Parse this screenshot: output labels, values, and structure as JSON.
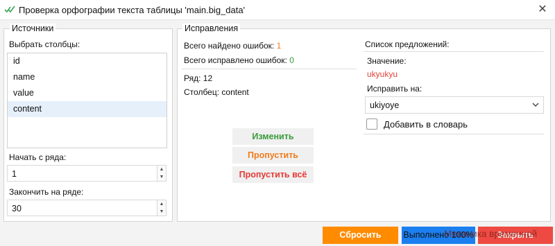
{
  "window": {
    "title": "Проверка орфографии текста таблицы 'main.big_data'",
    "close_glyph": "✕"
  },
  "sources": {
    "legend": "Источники",
    "select_columns_label": "Выбрать столбцы:",
    "columns": [
      "id",
      "name",
      "value",
      "content"
    ],
    "selected_column": "content",
    "start_row_label": "Начать с ряда:",
    "start_row_value": "1",
    "end_row_label": "Закончить на ряде:",
    "end_row_value": "30"
  },
  "fixes": {
    "legend": "Исправления",
    "errors_found_label": "Всего найдено ошибок:",
    "errors_found_value": "1",
    "errors_fixed_label": "Всего исправлено ошибок:",
    "errors_fixed_value": "0",
    "row_label": "Ряд: 12",
    "column_label": "Столбец: content",
    "change_button": "Изменить",
    "skip_button": "Пропустить",
    "skip_all_button": "Пропустить всё"
  },
  "suggestions": {
    "title": "Список предложений:",
    "value_label": "Значение:",
    "value": "ukyukyu",
    "fix_to_label": "Исправить на:",
    "fix_to_value": "ukiyoye",
    "add_to_dictionary_label": "Добавить в словарь"
  },
  "footer": {
    "reset_button": "Сбросить",
    "done_button": "Выполнено 100%",
    "close_button": "Закрыть",
    "watermark": "Механика временной"
  },
  "colors": {
    "accent_green": "#3a9a3a",
    "accent_orange": "#f07b1a",
    "accent_red": "#e53935",
    "value_red": "#e0443a",
    "reset_orange": "#ff8c00",
    "done_blue": "#1b7ff0",
    "close_red": "#ee4a43"
  }
}
